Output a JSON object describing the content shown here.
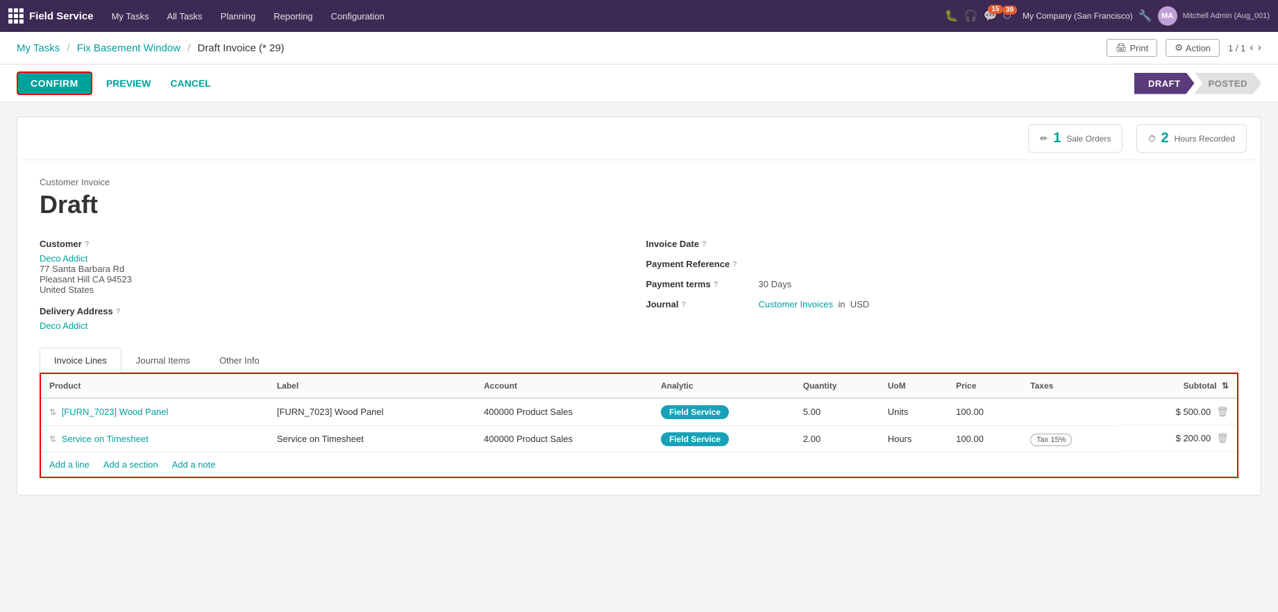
{
  "app": {
    "name": "Field Service",
    "grid_label": "apps-grid"
  },
  "topnav": {
    "menu": [
      {
        "label": "My Tasks",
        "id": "my-tasks"
      },
      {
        "label": "All Tasks",
        "id": "all-tasks"
      },
      {
        "label": "Planning",
        "id": "planning"
      },
      {
        "label": "Reporting",
        "id": "reporting"
      },
      {
        "label": "Configuration",
        "id": "configuration"
      }
    ],
    "notifications_count": "15",
    "timer_count": "39",
    "company": "My Company (San Francisco)",
    "user": "Mitchell Admin (Aug_001)"
  },
  "breadcrumb": {
    "parts": [
      "My Tasks",
      "Fix Basement Window"
    ],
    "current": "Draft Invoice (* 29)"
  },
  "toolbar": {
    "print_label": "Print",
    "action_label": "Action",
    "page_info": "1 / 1"
  },
  "action_bar": {
    "confirm_label": "CONFIRM",
    "preview_label": "PREVIEW",
    "cancel_label": "CANCEL"
  },
  "status": {
    "draft_label": "DRAFT",
    "posted_label": "POSTED"
  },
  "smart_buttons": [
    {
      "icon": "✏",
      "num": "1",
      "label": "Sale Orders"
    },
    {
      "icon": "⏱",
      "num": "2",
      "label": "Hours Recorded"
    }
  ],
  "invoice": {
    "type_label": "Customer Invoice",
    "status_title": "Draft",
    "customer_label": "Customer",
    "customer_name": "Deco Addict",
    "customer_address_1": "77 Santa Barbara Rd",
    "customer_address_2": "Pleasant Hill CA 94523",
    "customer_address_3": "United States",
    "delivery_address_label": "Delivery Address",
    "delivery_address_value": "Deco Addict",
    "invoice_date_label": "Invoice Date",
    "payment_reference_label": "Payment Reference",
    "payment_terms_label": "Payment terms",
    "payment_terms_value": "30 Days",
    "journal_label": "Journal",
    "journal_value": "Customer Invoices",
    "journal_currency_prefix": "in",
    "journal_currency": "USD"
  },
  "tabs": [
    {
      "label": "Invoice Lines",
      "active": true
    },
    {
      "label": "Journal Items",
      "active": false
    },
    {
      "label": "Other Info",
      "active": false
    }
  ],
  "table": {
    "columns": [
      "Product",
      "Label",
      "Account",
      "Analytic",
      "Quantity",
      "UoM",
      "Price",
      "Taxes",
      "Subtotal"
    ],
    "rows": [
      {
        "product": "[FURN_7023] Wood Panel",
        "label": "[FURN_7023] Wood Panel",
        "account": "400000 Product Sales",
        "analytic": "Field Service",
        "quantity": "5.00",
        "uom": "Units",
        "price": "100.00",
        "taxes": "",
        "subtotal": "$ 500.00"
      },
      {
        "product": "Service on Timesheet",
        "label": "Service on Timesheet",
        "account": "400000 Product Sales",
        "analytic": "Field Service",
        "quantity": "2.00",
        "uom": "Hours",
        "price": "100.00",
        "taxes": "Tax 15%",
        "subtotal": "$ 200.00"
      }
    ]
  },
  "add_links": [
    {
      "label": "Add a line"
    },
    {
      "label": "Add a section"
    },
    {
      "label": "Add a note"
    }
  ]
}
